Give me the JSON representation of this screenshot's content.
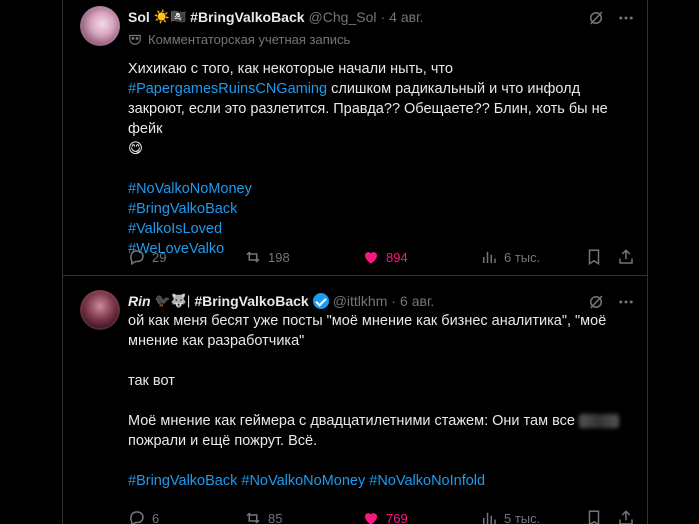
{
  "tweets": [
    {
      "author": {
        "name": "Sol",
        "emojis": "☀️🏴‍☠️",
        "display_tag": "#BringValkoBack",
        "handle": "@Chg_Sol",
        "date": "4 авг."
      },
      "sub_label": "Комментаторская учетная запись",
      "text_lines": [
        "Хихикаю с того, как некоторые начали ныть, что",
        "#PapergamesRuinsCNGaming",
        "слишком радикальный и что инфолд",
        "закроют, если это разлетится. Правда?? Обещаете?? Блин, хоть бы не фейк",
        "😋"
      ],
      "hashtags": [
        "#NoValkoNoMoney",
        "#BringValkoBack",
        "#ValkoIsLoved",
        "#WeLoveValko"
      ],
      "stats": {
        "replies": "29",
        "retweets": "198",
        "likes": "894",
        "views": "6 тыс."
      }
    },
    {
      "author": {
        "name": "Rin",
        "emojis": "🐦‍⬛🐺|",
        "display_tag": "#BringValkoBack",
        "handle": "@ittlkhm",
        "date": "6 авг."
      },
      "text_lines": [
        "ой как меня бесят уже посты \"моё мнение как бизнес аналитика\", \"моё",
        "мнение как разработчика\"",
        "так вот",
        "Моё мнение как геймера с двадцатилетними стажем: Они там все",
        "пожрали и ещё пожрут. Всё."
      ],
      "hashtags": [
        "#BringValkoBack",
        "#NoValkoNoMoney",
        "#NoValkoNoInfold"
      ],
      "stats": {
        "replies": "6",
        "retweets": "85",
        "likes": "769",
        "views": "5 тыс."
      }
    }
  ],
  "colors": {
    "background": "#000000",
    "text": "#e7e9ea",
    "muted": "#71767b",
    "link": "#1d9bf0",
    "like": "#f91880",
    "border": "#2f3336"
  },
  "icons": [
    "grok-icon",
    "more-icon",
    "reply-icon",
    "retweet-icon",
    "heart-filled-icon",
    "views-icon",
    "bookmark-icon",
    "share-icon",
    "verified-badge-icon",
    "mask-icon"
  ]
}
